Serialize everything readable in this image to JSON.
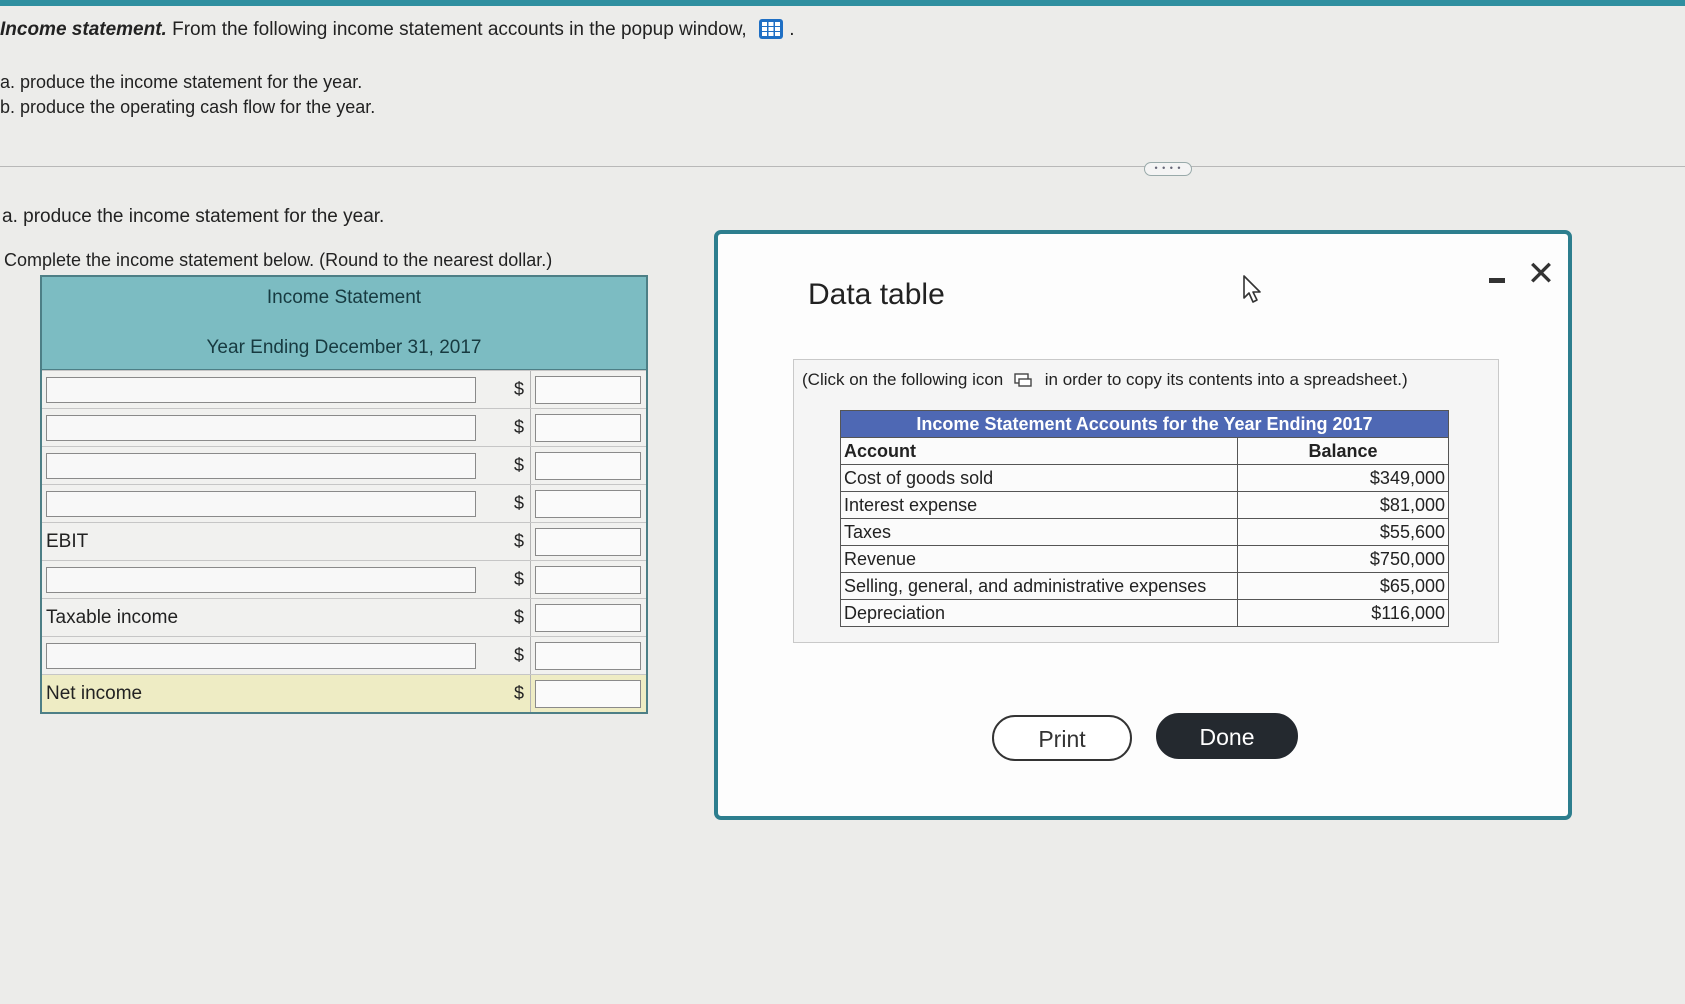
{
  "question": {
    "title": "Income statement.",
    "text": "From the following income statement accounts in the popup window,",
    "parts": [
      "a. produce the income statement for the year.",
      "b. produce the operating cash flow for the year."
    ]
  },
  "section_a": {
    "heading": "a. produce the income statement for the year.",
    "instruction": "Complete the income statement below. (Round to the nearest dollar.)"
  },
  "income_statement": {
    "title": "Income Statement",
    "period": "Year Ending December 31, 2017",
    "currency": "$",
    "rows": [
      {
        "label": "",
        "input": true
      },
      {
        "label": "",
        "input": true
      },
      {
        "label": "",
        "input": true
      },
      {
        "label": "",
        "input": true
      },
      {
        "label": "EBIT",
        "input": false
      },
      {
        "label": "",
        "input": true
      },
      {
        "label": "Taxable income",
        "input": false
      },
      {
        "label": "",
        "input": true
      },
      {
        "label": "Net income",
        "input": false
      }
    ]
  },
  "popup": {
    "title": "Data table",
    "note_before": "(Click on the following icon",
    "note_after": "in order to copy its contents into a spreadsheet.)",
    "table_caption": "Income Statement Accounts for the Year Ending 2017",
    "col_account": "Account",
    "col_balance": "Balance",
    "rows": [
      {
        "account": "Cost of goods sold",
        "balance": "$349,000"
      },
      {
        "account": "Interest expense",
        "balance": "$81,000"
      },
      {
        "account": "Taxes",
        "balance": "$55,600"
      },
      {
        "account": "Revenue",
        "balance": "$750,000"
      },
      {
        "account": "Selling, general, and administrative expenses",
        "balance": "$65,000"
      },
      {
        "account": "Depreciation",
        "balance": "$116,000"
      }
    ],
    "print_label": "Print",
    "done_label": "Done"
  },
  "colors": {
    "accent": "#2d7e8e",
    "table_header": "#7cbcc2",
    "data_caption": "#4e68b4",
    "done_button": "#24292f",
    "net_income_row": "#eeecc4"
  }
}
